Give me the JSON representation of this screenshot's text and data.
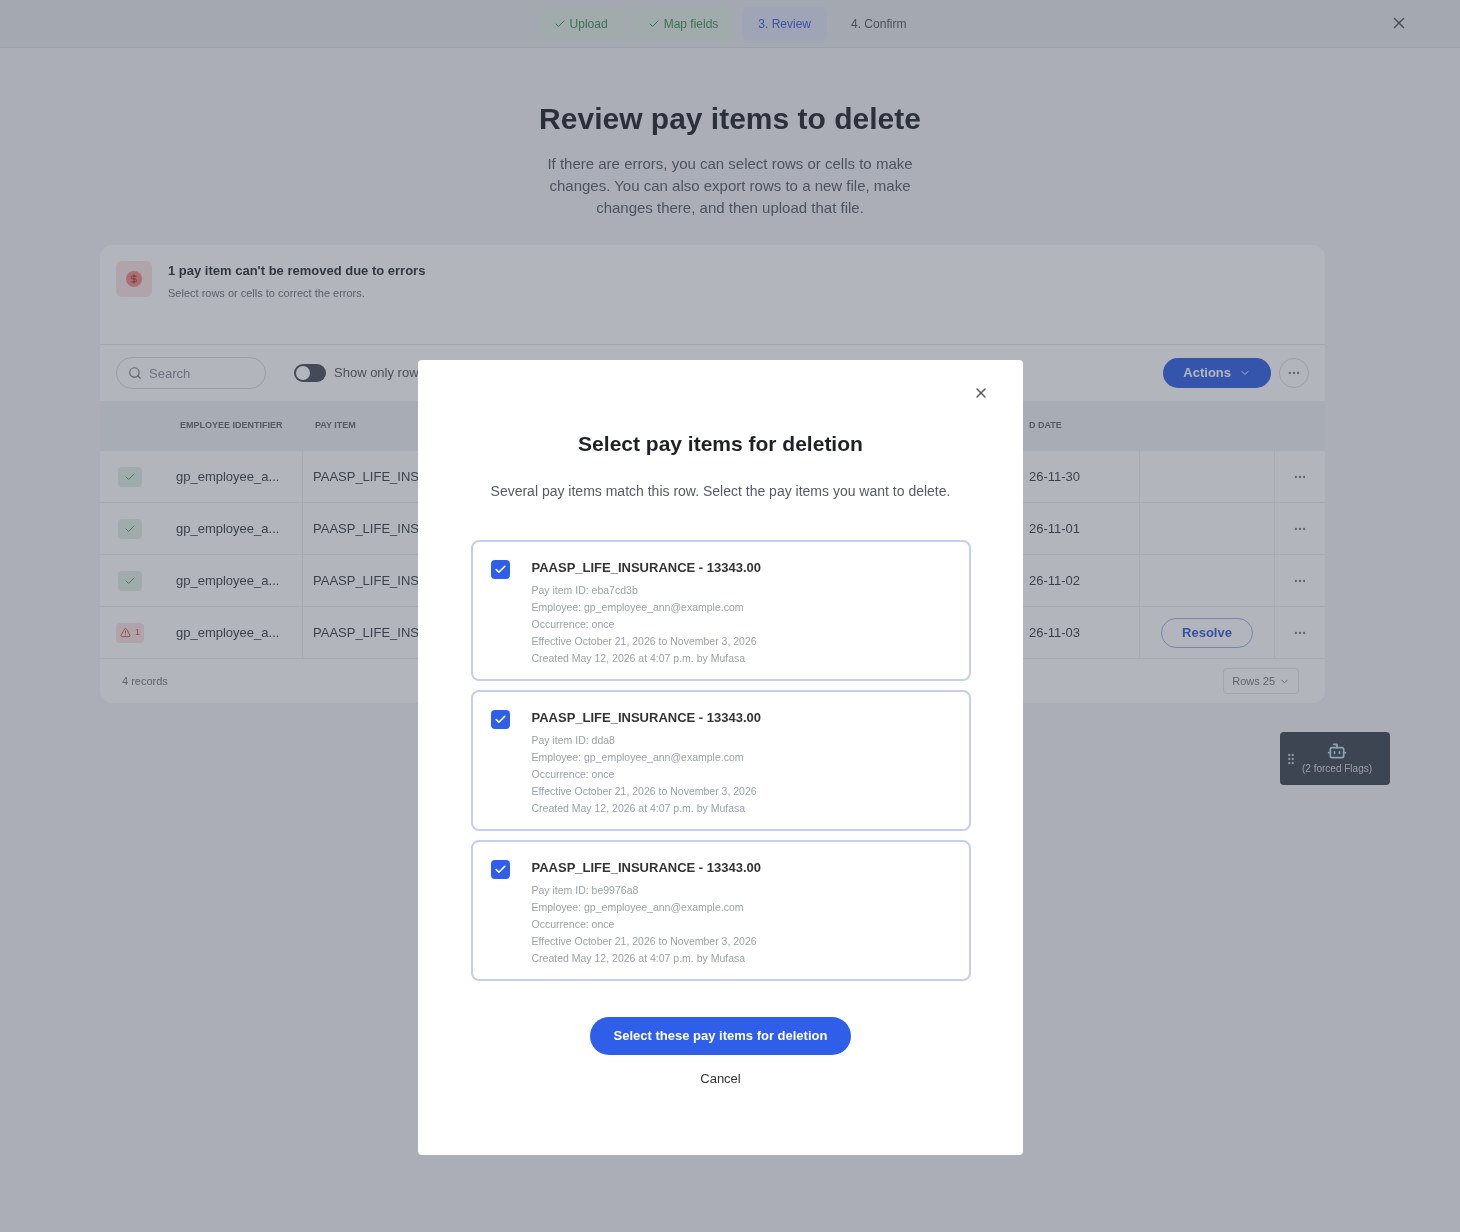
{
  "stepper": [
    {
      "label": "Upload",
      "done": true,
      "selected": false
    },
    {
      "label": "Map fields",
      "done": true,
      "selected": false
    },
    {
      "label": "3. Review",
      "done": false,
      "selected": true
    },
    {
      "label": "4. Confirm",
      "done": false,
      "selected": false
    }
  ],
  "page": {
    "title": "Review pay items to delete",
    "description": "If there are errors, you can select rows or cells to make changes. You can also export rows to a new file, make changes there, and then upload that file."
  },
  "error_banner": {
    "title": "1 pay item can't be removed due to errors",
    "subtitle": "Select rows or cells to correct the errors."
  },
  "toolbar": {
    "search": {
      "placeholder": "Search"
    },
    "toggles": [
      {
        "label": "Show only row",
        "on": false
      }
    ],
    "actions_button": "Actions"
  },
  "table": {
    "columns": [
      "EMPLOYEE IDENTIFIER",
      "PAY ITEM",
      "D DATE"
    ],
    "rows": [
      {
        "kind": "ok",
        "error_count": "",
        "employee": "gp_employee_a...",
        "pay_item": "PAASP_LIFE_INS",
        "end_date": "26-11-30",
        "action": ""
      },
      {
        "kind": "ok",
        "error_count": "",
        "employee": "gp_employee_a...",
        "pay_item": "PAASP_LIFE_INS",
        "end_date": "26-11-01",
        "action": ""
      },
      {
        "kind": "ok",
        "error_count": "",
        "employee": "gp_employee_a...",
        "pay_item": "PAASP_LIFE_INS",
        "end_date": "26-11-02",
        "action": ""
      },
      {
        "kind": "error",
        "error_count": "1",
        "employee": "gp_employee_a...",
        "pay_item": "PAASP_LIFE_INS",
        "end_date": "26-11-03",
        "action": "Resolve"
      }
    ],
    "record_count": "4 records",
    "rows_per_page": "Rows 25"
  },
  "flags_widget": {
    "label": "(2 forced Flags)"
  },
  "dialog": {
    "title": "Select pay items for deletion",
    "description": "Several pay items match this row. Select the pay items you want to delete.",
    "items": [
      {
        "title": "PAASP_LIFE_INSURANCE - 13343.00",
        "checked": true,
        "details": [
          "Pay item ID: eba7cd3b",
          "Employee: gp_employee_ann@example.com",
          "Occurrence: once",
          "Effective October 21, 2026 to November 3, 2026",
          "Created May 12, 2026 at 4:07 p.m. by Mufasa"
        ]
      },
      {
        "title": "PAASP_LIFE_INSURANCE - 13343.00",
        "checked": true,
        "details": [
          "Pay item ID: dda8",
          "Employee: gp_employee_ann@example.com",
          "Occurrence: once",
          "Effective October 21, 2026 to November 3, 2026",
          "Created May 12, 2026 at 4:07 p.m. by Mufasa"
        ]
      },
      {
        "title": "PAASP_LIFE_INSURANCE - 13343.00",
        "checked": true,
        "details": [
          "Pay item ID: be9976a8",
          "Employee: gp_employee_ann@example.com",
          "Occurrence: once",
          "Effective October 21, 2026 to November 3, 2026",
          "Created May 12, 2026 at 4:07 p.m. by Mufasa"
        ]
      }
    ],
    "primary_button": "Select these pay items for deletion",
    "cancel_button": "Cancel"
  }
}
